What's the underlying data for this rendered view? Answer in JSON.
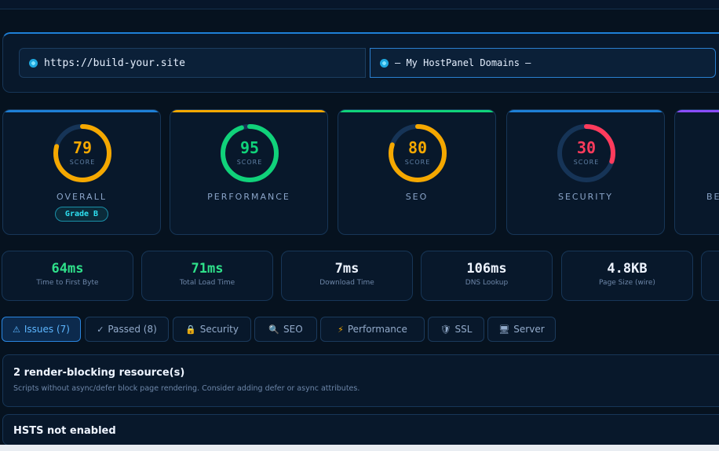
{
  "url_bar": {
    "url": "https://build-your.site",
    "domain_select": "— My HostPanel Domains —"
  },
  "scores": [
    {
      "value": "79",
      "score_label": "SCORE",
      "title": "OVERALL",
      "grade": "Grade B",
      "fraction": 0.79,
      "color": "#f5a800",
      "accent": "#1e7fd6"
    },
    {
      "value": "95",
      "score_label": "SCORE",
      "title": "PERFORMANCE",
      "fraction": 0.95,
      "color": "#10d27a",
      "accent": "#f5a800"
    },
    {
      "value": "80",
      "score_label": "SCORE",
      "title": "SEO",
      "fraction": 0.8,
      "color": "#f5a800",
      "accent": "#10d27a"
    },
    {
      "value": "30",
      "score_label": "SCORE",
      "title": "SECURITY",
      "fraction": 0.3,
      "color": "#ff3b5c",
      "accent": "#1e7fd6"
    },
    {
      "title": "BE",
      "accent": "#8a4dff"
    }
  ],
  "metrics": [
    {
      "value": "64ms",
      "caption": "Time to First Byte",
      "color": "#2fe08a"
    },
    {
      "value": "71ms",
      "caption": "Total Load Time",
      "color": "#2fe08a"
    },
    {
      "value": "7ms",
      "caption": "Download Time",
      "color": "#eef4ff"
    },
    {
      "value": "106ms",
      "caption": "DNS Lookup",
      "color": "#eef4ff"
    },
    {
      "value": "4.8KB",
      "caption": "Page Size (wire)",
      "color": "#eef4ff"
    }
  ],
  "tabs": [
    {
      "icon": "⚠",
      "label": "Issues (7)"
    },
    {
      "icon": "✓",
      "label": "Passed (8)"
    },
    {
      "icon": "🔒",
      "label": "Security"
    },
    {
      "icon": "🔍",
      "label": "SEO"
    },
    {
      "icon": "⚡",
      "label": "Performance"
    },
    {
      "icon": "🛡",
      "label": "SSL"
    },
    {
      "icon": "🖥",
      "label": "Server"
    }
  ],
  "issues": [
    {
      "title": "2 render-blocking resource(s)",
      "description": "Scripts without async/defer block page rendering. Consider adding defer or async attributes."
    },
    {
      "title": "HSTS not enabled"
    }
  ]
}
